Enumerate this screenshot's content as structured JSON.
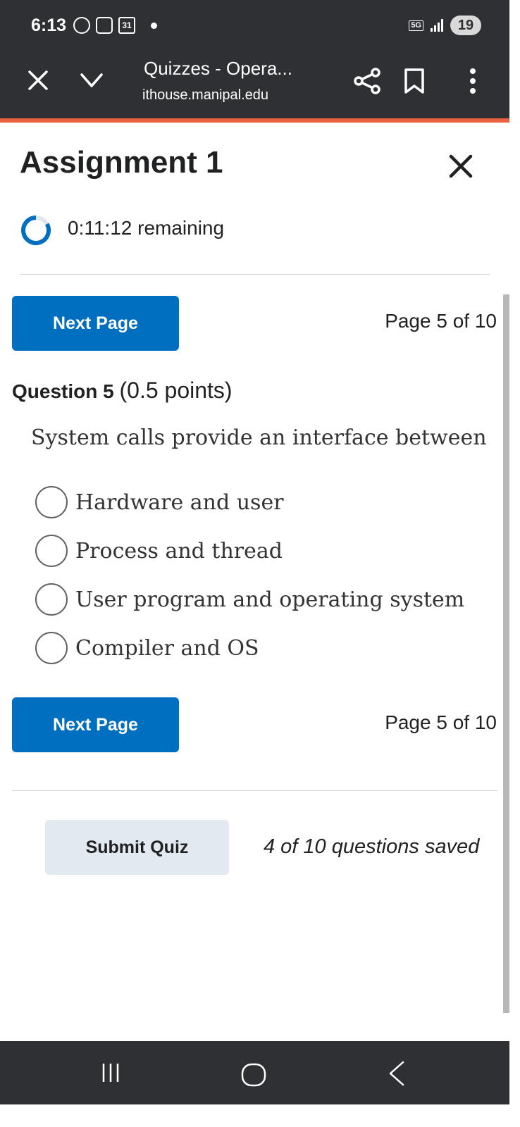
{
  "status_bar": {
    "time": "6:13",
    "calendar_day": "31",
    "network": "5G",
    "battery": "19"
  },
  "browser": {
    "page_title": "Quizzes - Opera...",
    "url": "ithouse.manipal.edu"
  },
  "quiz": {
    "title": "Assignment 1",
    "timer": "0:11:12 remaining",
    "next_page_label": "Next Page",
    "page_indicator": "Page 5 of 10",
    "question": {
      "number_label": "Question 5",
      "points_label": "(0.5 points)",
      "text": "System calls provide an interface between",
      "options": [
        "Hardware and user",
        "Process and thread",
        "User program and operating system",
        "Compiler and OS"
      ]
    },
    "submit_label": "Submit Quiz",
    "saved_status": "4 of 10 questions saved"
  },
  "colors": {
    "header_bg": "#2f3033",
    "accent_line": "#e9623e",
    "primary_button": "#006fbf",
    "secondary_button": "#e3e9f1"
  }
}
